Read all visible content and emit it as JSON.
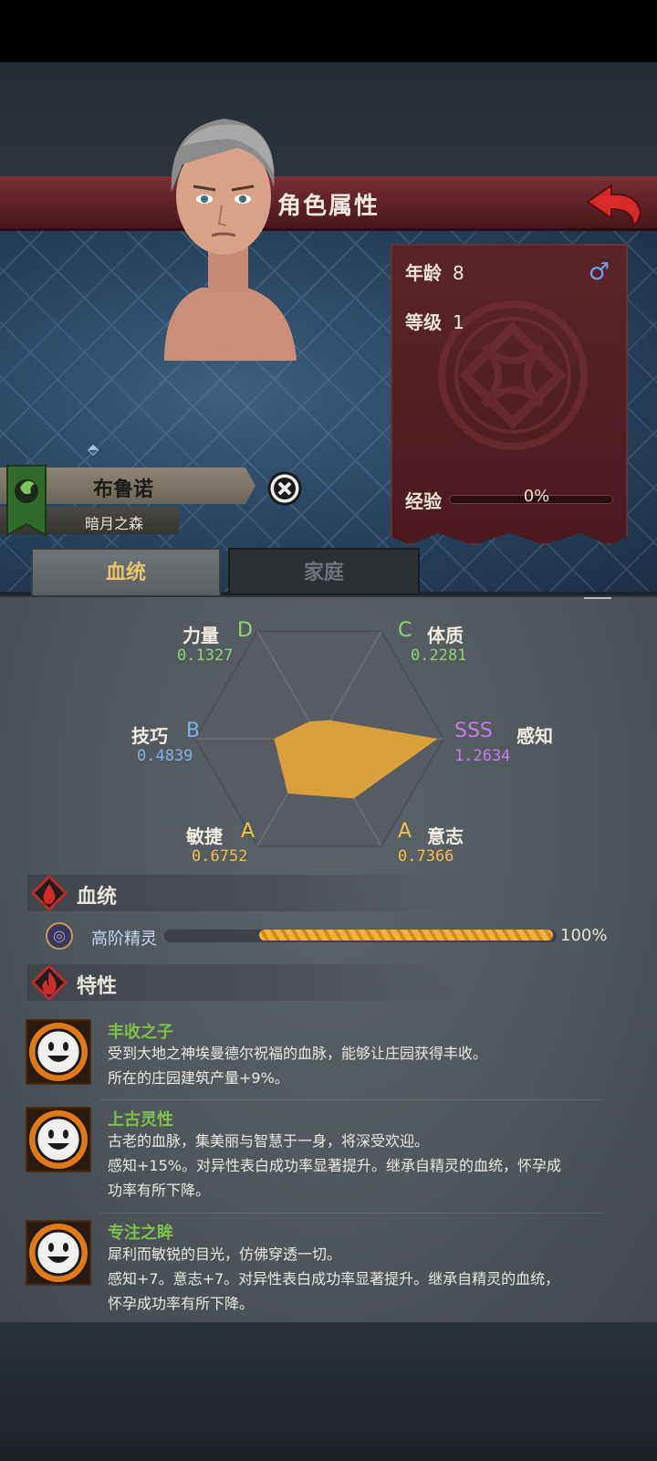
{
  "header": {
    "title": "角色属性",
    "back_icon": "back-arrow-icon"
  },
  "character": {
    "name": "布鲁诺",
    "faction": "暗月之森",
    "age_label": "年龄",
    "age_value": "8",
    "level_label": "等级",
    "level_value": "1",
    "exp_label": "经验",
    "exp_value": "0%",
    "exp_progress": 0,
    "gender_icon": "male-icon",
    "gender_symbol": "♂"
  },
  "tabs": [
    {
      "label": "血统",
      "active": true
    },
    {
      "label": "家庭",
      "active": false
    }
  ],
  "stats": [
    {
      "name": "力量",
      "grade": "D",
      "value": "0.1327",
      "color": "#8fd47a"
    },
    {
      "name": "体质",
      "grade": "C",
      "value": "0.2281",
      "color": "#8fd47a"
    },
    {
      "name": "感知",
      "grade": "SSS",
      "value": "1.2634",
      "color": "#c77be8"
    },
    {
      "name": "意志",
      "grade": "A",
      "value": "0.7366",
      "color": "#f0c24a"
    },
    {
      "name": "敏捷",
      "grade": "A",
      "value": "0.6752",
      "color": "#f0c24a"
    },
    {
      "name": "技巧",
      "grade": "B",
      "value": "0.4839",
      "color": "#7fb0e6"
    }
  ],
  "radar_fill_color": "#d9a03c",
  "bloodline": {
    "section_title": "血统",
    "entries": [
      {
        "name": "高阶精灵",
        "percent": "100%",
        "progress": 1.0
      }
    ]
  },
  "traits": {
    "section_title": "特性",
    "items": [
      {
        "title": "丰收之子",
        "lines": [
          "受到大地之神埃曼德尔祝福的血脉，能够让庄园获得丰收。",
          "所在的庄园建筑产量+9%。"
        ]
      },
      {
        "title": "上古灵性",
        "lines": [
          "古老的血脉，集美丽与智慧于一身，将深受欢迎。",
          "感知+15%。对异性表白成功率显著提升。继承自精灵的血统，怀孕成",
          "功率有所下降。"
        ]
      },
      {
        "title": "专注之眸",
        "lines": [
          "犀利而敏锐的目光，仿佛穿透一切。",
          "感知+7。意志+7。对异性表白成功率显著提升。继承自精灵的血统，",
          "怀孕成功率有所下降。"
        ]
      }
    ]
  }
}
